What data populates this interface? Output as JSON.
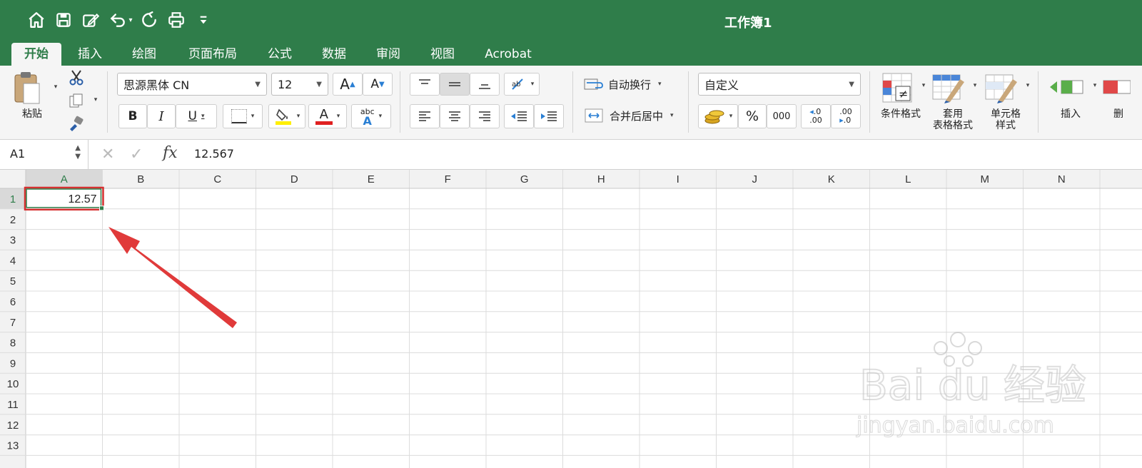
{
  "window": {
    "title": "工作簿1"
  },
  "qat": {
    "icons": [
      "home-icon",
      "save-icon",
      "edit-icon",
      "undo-icon",
      "redo-icon",
      "print-icon",
      "customize-icon"
    ]
  },
  "tabs": [
    {
      "label": "开始",
      "active": true
    },
    {
      "label": "插入"
    },
    {
      "label": "绘图"
    },
    {
      "label": "页面布局"
    },
    {
      "label": "公式"
    },
    {
      "label": "数据"
    },
    {
      "label": "审阅"
    },
    {
      "label": "视图"
    },
    {
      "label": "Acrobat"
    }
  ],
  "ribbon": {
    "paste_label": "粘贴",
    "font_name": "思源黑体 CN",
    "font_size": "12",
    "grow_font": "A",
    "shrink_font": "A",
    "bold": "B",
    "italic": "I",
    "underline": "U",
    "text_color_label": "A",
    "phonetic_top": "abc",
    "phonetic_bottom": "A",
    "wrap_text": "自动换行",
    "merge_center": "合并后居中",
    "number_format": "自定义",
    "percent": "%",
    "comma": "000",
    "inc_decimal_top": ".0",
    "inc_decimal_bottom": ".00",
    "dec_decimal_top": ".00",
    "dec_decimal_bottom": ".0",
    "conditional_format": "条件格式",
    "table_format_line1": "套用",
    "table_format_line2": "表格格式",
    "cell_style_line1": "单元格",
    "cell_style_line2": "样式",
    "insert": "插入",
    "delete_partial": "删",
    "colors": {
      "fill": "#ffef00",
      "font": "#e02020",
      "accent": "#2f7d4a"
    }
  },
  "formula_bar": {
    "name_box": "A1",
    "fx_label": "fx",
    "value": "12.567"
  },
  "sheet": {
    "columns": [
      "A",
      "B",
      "C",
      "D",
      "E",
      "F",
      "G",
      "H",
      "I",
      "J",
      "K",
      "L",
      "M",
      "N"
    ],
    "rows": [
      "1",
      "2",
      "3",
      "4",
      "5",
      "6",
      "7",
      "8",
      "9",
      "10",
      "11",
      "12",
      "13"
    ],
    "selected_cell": "A1",
    "cells": [
      {
        "ref": "A1",
        "value": "12.57"
      }
    ]
  },
  "watermark": {
    "brand": "Bai du 经验",
    "url": "jingyan.baidu.com"
  }
}
